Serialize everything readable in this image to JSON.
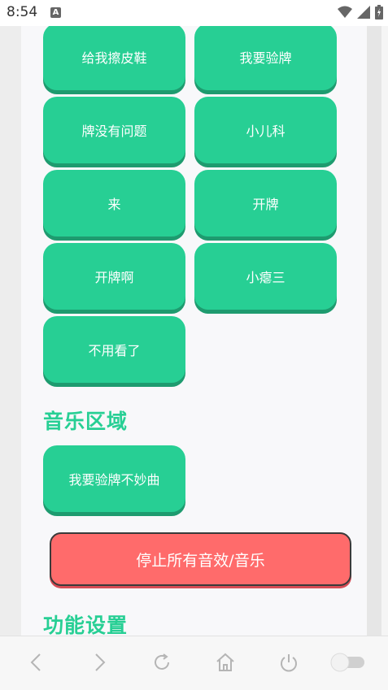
{
  "status_bar": {
    "time": "8:54",
    "notification_icon": "a-icon",
    "icons": [
      "wifi-icon",
      "signal-icon",
      "battery-icon"
    ]
  },
  "sound_buttons": [
    {
      "label": "给我擦皮鞋"
    },
    {
      "label": "我要验牌"
    },
    {
      "label": "牌没有问题"
    },
    {
      "label": "小儿科"
    },
    {
      "label": "来"
    },
    {
      "label": "开牌"
    },
    {
      "label": "开牌啊"
    },
    {
      "label": "小瘪三"
    },
    {
      "label": "不用看了"
    }
  ],
  "music_section": {
    "title": "音乐区域",
    "buttons": [
      {
        "label": "我要验牌不妙曲"
      }
    ]
  },
  "stop_button": {
    "label": "停止所有音效/音乐"
  },
  "settings_section": {
    "title": "功能设置"
  },
  "bottom_nav": {
    "icons": [
      "back-icon",
      "forward-icon",
      "refresh-icon",
      "home-icon",
      "power-icon",
      "toggle-switch"
    ]
  },
  "colors": {
    "accent": "#27cf94",
    "accent_shadow": "#1e9b6f",
    "stop": "#ff6b6b"
  }
}
